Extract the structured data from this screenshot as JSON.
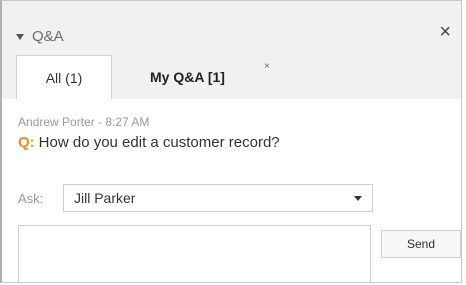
{
  "panel": {
    "title": "Q&A",
    "close_glyph": "×"
  },
  "tabs": [
    {
      "label": "All (1)",
      "active": true
    },
    {
      "label": "My Q&A [1]",
      "active": false,
      "close_glyph": "×"
    }
  ],
  "question": {
    "author_time": "Andrew Porter - 8:27 AM",
    "marker": "Q:",
    "text": "How do you edit a customer record?",
    "marker_color": "#f08a24"
  },
  "ask": {
    "label": "Ask:",
    "selected": "Jill Parker"
  },
  "compose": {
    "placeholder": "",
    "send_label": "Send"
  }
}
